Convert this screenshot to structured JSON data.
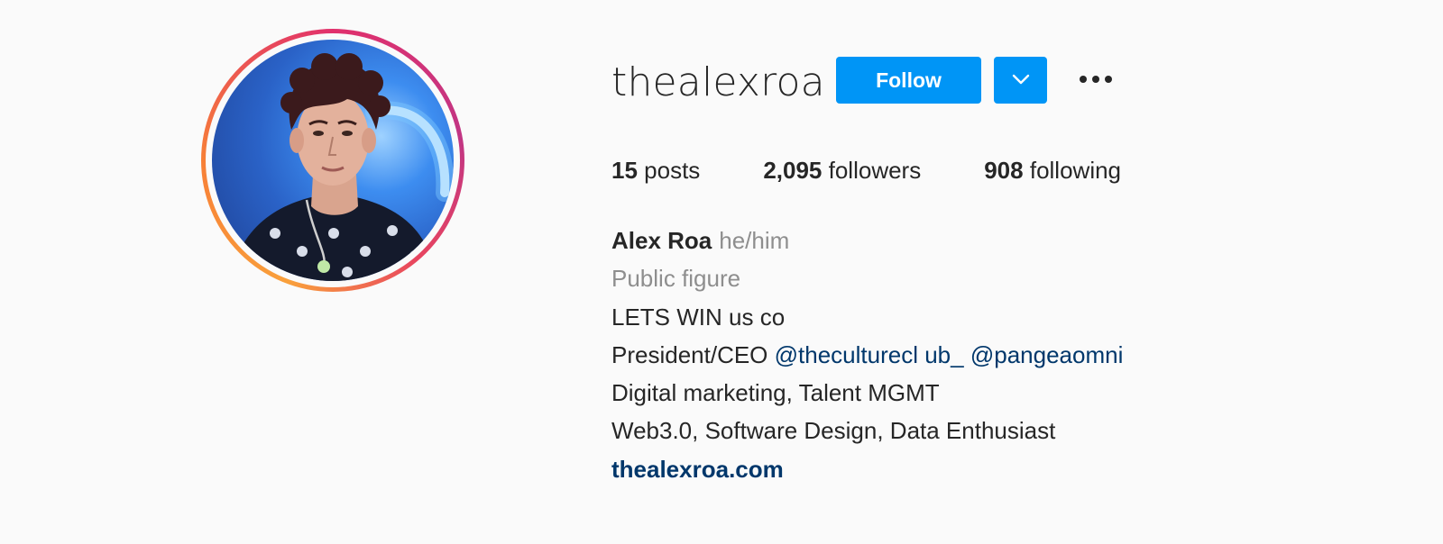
{
  "profile": {
    "username": "thealexroa",
    "follow_label": "Follow",
    "stats": {
      "posts_count": "15",
      "posts_label": "posts",
      "followers_count": "2,095",
      "followers_label": "followers",
      "following_count": "908",
      "following_label": "following"
    },
    "bio": {
      "full_name": "Alex Roa",
      "pronouns": "he/him",
      "category": "Public figure",
      "line1": "LETS WIN us co",
      "line2_prefix": "President/CEO",
      "mention1": "@theculturecl ub_",
      "mention2": "@pangeaomni",
      "line3": "Digital marketing, Talent MGMT",
      "line4": "Web3.0, Software Design, Data Enthusiast",
      "website": "thealexroa.com"
    }
  },
  "icons": {
    "dropdown": "chevron-down-icon",
    "more": "more-horizontal-icon"
  },
  "colors": {
    "background": "#fafafa",
    "primary_button": "#0095f6",
    "link": "#00376b",
    "secondary_text": "#8e8e8e",
    "text": "#262626"
  }
}
